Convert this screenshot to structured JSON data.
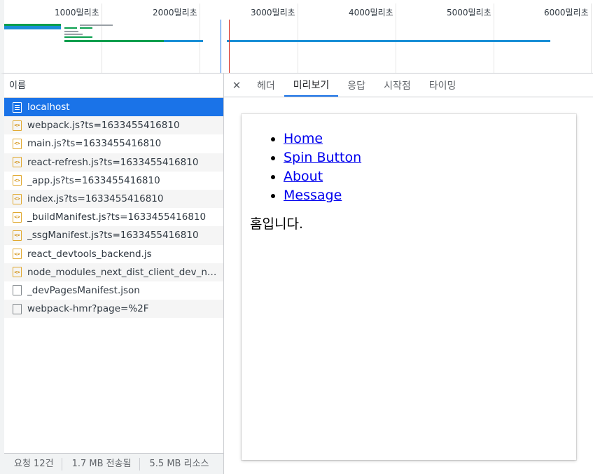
{
  "overview": {
    "ticks": [
      "1000밀리초",
      "2000밀리초",
      "3000밀리초",
      "4000밀리초",
      "5000밀리초",
      "6000밀리초"
    ]
  },
  "request_list": {
    "header": "이름",
    "requests": [
      {
        "name": "localhost",
        "type": "document"
      },
      {
        "name": "webpack.js?ts=1633455416810",
        "type": "script"
      },
      {
        "name": "main.js?ts=1633455416810",
        "type": "script"
      },
      {
        "name": "react-refresh.js?ts=1633455416810",
        "type": "script"
      },
      {
        "name": "_app.js?ts=1633455416810",
        "type": "script"
      },
      {
        "name": "index.js?ts=1633455416810",
        "type": "script"
      },
      {
        "name": "_buildManifest.js?ts=1633455416810",
        "type": "script"
      },
      {
        "name": "_ssgManifest.js?ts=1633455416810",
        "type": "script"
      },
      {
        "name": "react_devtools_backend.js",
        "type": "script"
      },
      {
        "name": "node_modules_next_dist_client_dev_no...",
        "type": "script"
      },
      {
        "name": "_devPagesManifest.json",
        "type": "other"
      },
      {
        "name": "webpack-hmr?page=%2F",
        "type": "other"
      }
    ],
    "selected_index": 0
  },
  "status_bar": {
    "requests": "요청 12건",
    "transferred": "1.7 MB 전송됨",
    "resources": "5.5 MB 리소스"
  },
  "detail": {
    "close_icon": "close-icon",
    "tabs": [
      "헤더",
      "미리보기",
      "응답",
      "시작점",
      "타이밍"
    ],
    "active_tab": "미리보기"
  },
  "preview": {
    "nav_links": [
      "Home",
      "Spin Button",
      "About",
      "Message"
    ],
    "page_text": "홈입니다."
  },
  "colors": {
    "selection": "#1a73e8",
    "link": "#0000ee",
    "waterfall_green": "#0a9f4e",
    "waterfall_blue": "#1a8fd6",
    "dom_content_loaded": "#1a73e8",
    "load_event": "#d93025"
  }
}
